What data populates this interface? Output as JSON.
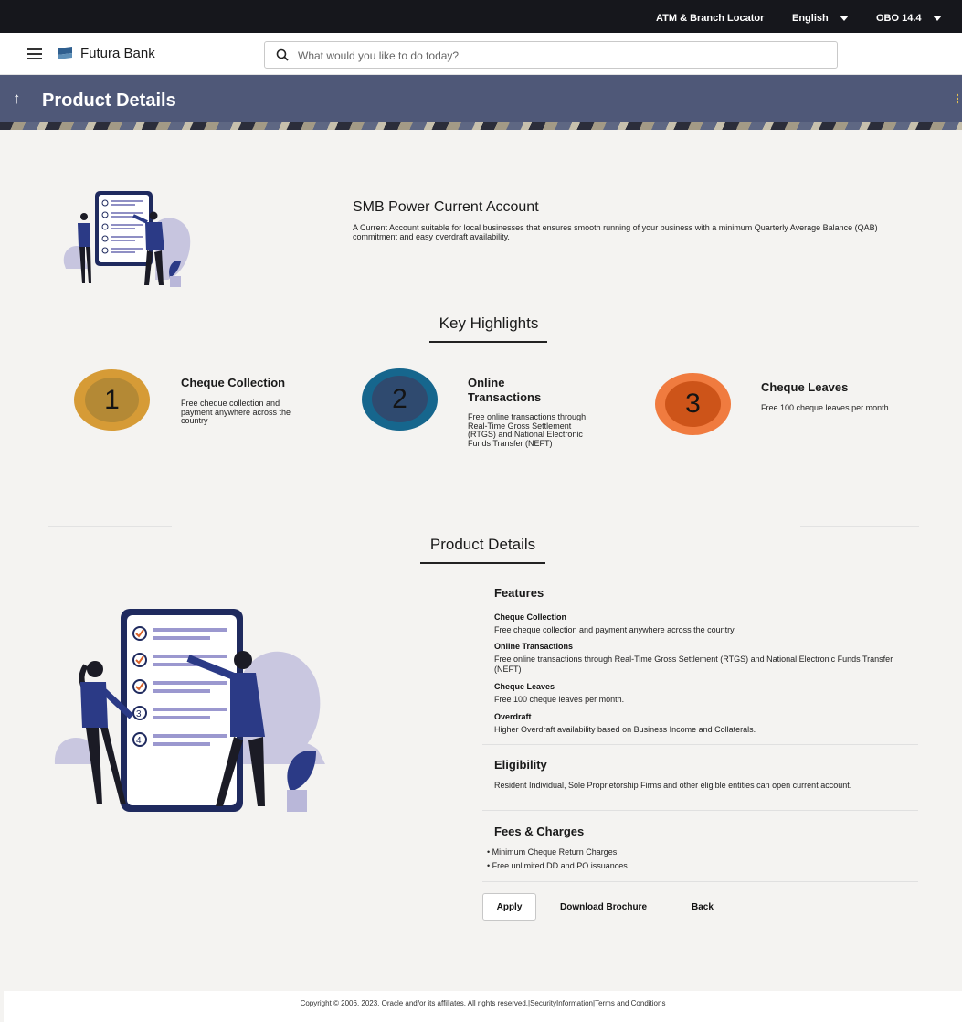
{
  "topbar": {
    "atm_locator": "ATM & Branch Locator",
    "language": "English",
    "user": "OBO 14.4"
  },
  "header": {
    "brand": "Futura Bank",
    "search_placeholder": "What would you like to do today?"
  },
  "page": {
    "title": "Product Details"
  },
  "account": {
    "name": "SMB Power Current Account",
    "description": "A Current Account suitable for local businesses that ensures smooth running of your business with a minimum Quarterly Average Balance (QAB) commitment and easy overdraft availability."
  },
  "highlights": {
    "heading": "Key Highlights",
    "items": [
      {
        "number": "1",
        "title": "Cheque Collection",
        "desc": "Free cheque collection and payment anywhere across the country",
        "outer": "#d69b36",
        "inner": "#b48935"
      },
      {
        "number": "2",
        "title": "Online Transactions",
        "desc": "Free online transactions through Real-Time Gross Settlement (RTGS) and National Electronic Funds Transfer (NEFT)",
        "outer": "#16668d",
        "inner": "#2f4a6f"
      },
      {
        "number": "3",
        "title": "Cheque Leaves",
        "desc": "Free 100 cheque leaves per month.",
        "outer": "#f07b3f",
        "inner": "#cd5419"
      }
    ]
  },
  "details": {
    "heading": "Product Details",
    "features_title": "Features",
    "features": [
      {
        "title": "Cheque Collection",
        "text": "Free cheque collection and payment anywhere across the country"
      },
      {
        "title": "Online Transactions",
        "text": "Free online transactions through Real-Time Gross Settlement (RTGS) and National Electronic Funds Transfer (NEFT)"
      },
      {
        "title": "Cheque Leaves",
        "text": "Free 100 cheque leaves per month."
      },
      {
        "title": "Overdraft",
        "text": "Higher Overdraft availability based on Business Income and Collaterals."
      }
    ],
    "eligibility_title": "Eligibility",
    "eligibility_text": "Resident Individual, Sole Proprietorship Firms and other eligible entities can open current account.",
    "fees_title": "Fees & Charges",
    "fees": [
      "Minimum Cheque Return Charges",
      "Free unlimited DD and PO issuances"
    ]
  },
  "actions": {
    "apply": "Apply",
    "download": "Download Brochure",
    "back": "Back"
  },
  "footer": {
    "text": "Copyright © 2006, 2023, Oracle and/or its affiliates. All rights reserved.|SecurityInformation|Terms and Conditions"
  },
  "colors": {
    "banner": "#4f5878",
    "topbar": "#16171c",
    "illustration_navy": "#1f2a5e",
    "illustration_lavender": "#b9b7d9"
  }
}
